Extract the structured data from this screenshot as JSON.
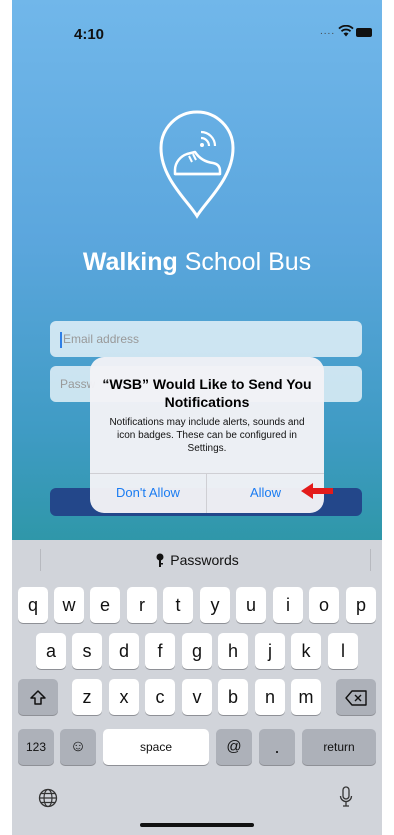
{
  "status_bar": {
    "time": "4:10",
    "dots": "...."
  },
  "app": {
    "title_bold": "Walking",
    "title_rest": " School Bus",
    "email_placeholder": "Email address",
    "password_placeholder": "Passw"
  },
  "alert": {
    "title": "“WSB” Would Like to Send You Notifications",
    "message": "Notifications may include alerts, sounds and icon badges. These can be configured in Settings.",
    "dont_allow": "Don't Allow",
    "allow": "Allow"
  },
  "keyboard": {
    "suggestion": "Passwords",
    "row1": [
      "q",
      "w",
      "e",
      "r",
      "t",
      "y",
      "u",
      "i",
      "o",
      "p"
    ],
    "row2": [
      "a",
      "s",
      "d",
      "f",
      "g",
      "h",
      "j",
      "k",
      "l"
    ],
    "row3": [
      "z",
      "x",
      "c",
      "v",
      "b",
      "n",
      "m"
    ],
    "numbers_key": "123",
    "emoji_key": "☺",
    "space_key": "space",
    "at_key": "@",
    "dot_key": ".",
    "return_key": "return"
  },
  "colors": {
    "accent": "#1a7cf2",
    "arrow": "#e31b1b",
    "button_navy": "#23478a"
  }
}
